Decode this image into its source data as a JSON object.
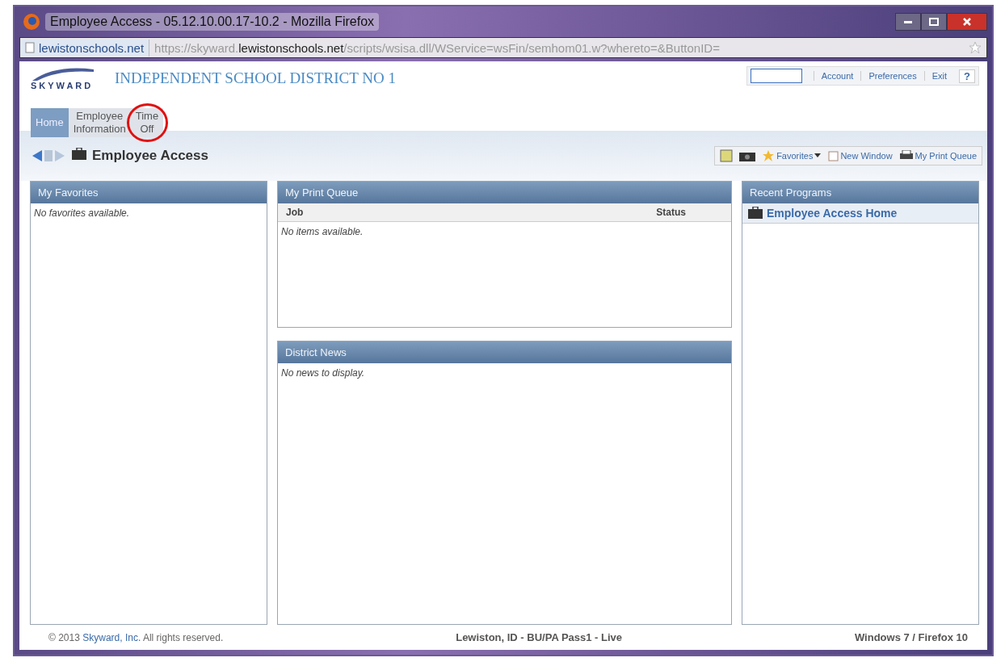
{
  "window": {
    "title": "Employee Access - 05.12.10.00.17-10.2 - Mozilla Firefox"
  },
  "address_bar": {
    "site": "lewistonschools.net",
    "url_prefix": "https://skyward.",
    "url_host": "lewistonschools.net",
    "url_rest": "/scripts/wsisa.dll/WService=wsFin/semhom01.w?whereto=&ButtonID="
  },
  "header": {
    "district": "INDEPENDENT SCHOOL DISTRICT NO 1",
    "logo": "SKYWARD",
    "links": [
      "Account",
      "Preferences",
      "Exit"
    ],
    "help": "?"
  },
  "tabs": [
    {
      "lines": [
        "Home"
      ],
      "selected": true,
      "circled": false
    },
    {
      "lines": [
        "Employee",
        "Information"
      ],
      "selected": false,
      "circled": false
    },
    {
      "lines": [
        "Time",
        "Off"
      ],
      "selected": false,
      "circled": true
    }
  ],
  "page_title": "Employee Access",
  "toolbar": {
    "favorites": "Favorites",
    "new_window": "New Window",
    "print_queue": "My Print Queue"
  },
  "favorites": {
    "title": "My Favorites",
    "empty": "No favorites available."
  },
  "print_queue": {
    "title": "My Print Queue",
    "columns": [
      "Job",
      "Status"
    ],
    "empty": "No items available."
  },
  "news": {
    "title": "District News",
    "empty": "No news to display."
  },
  "recent": {
    "title": "Recent Programs",
    "items": [
      "Employee Access Home"
    ]
  },
  "footer": {
    "copyright_before": "© 2013",
    "copyright_link": "Skyward, Inc.",
    "copyright_after": "All rights reserved.",
    "server": "Lewiston, ID - BU/PA Pass1 - Live",
    "platform": "Windows 7 / Firefox 10"
  }
}
